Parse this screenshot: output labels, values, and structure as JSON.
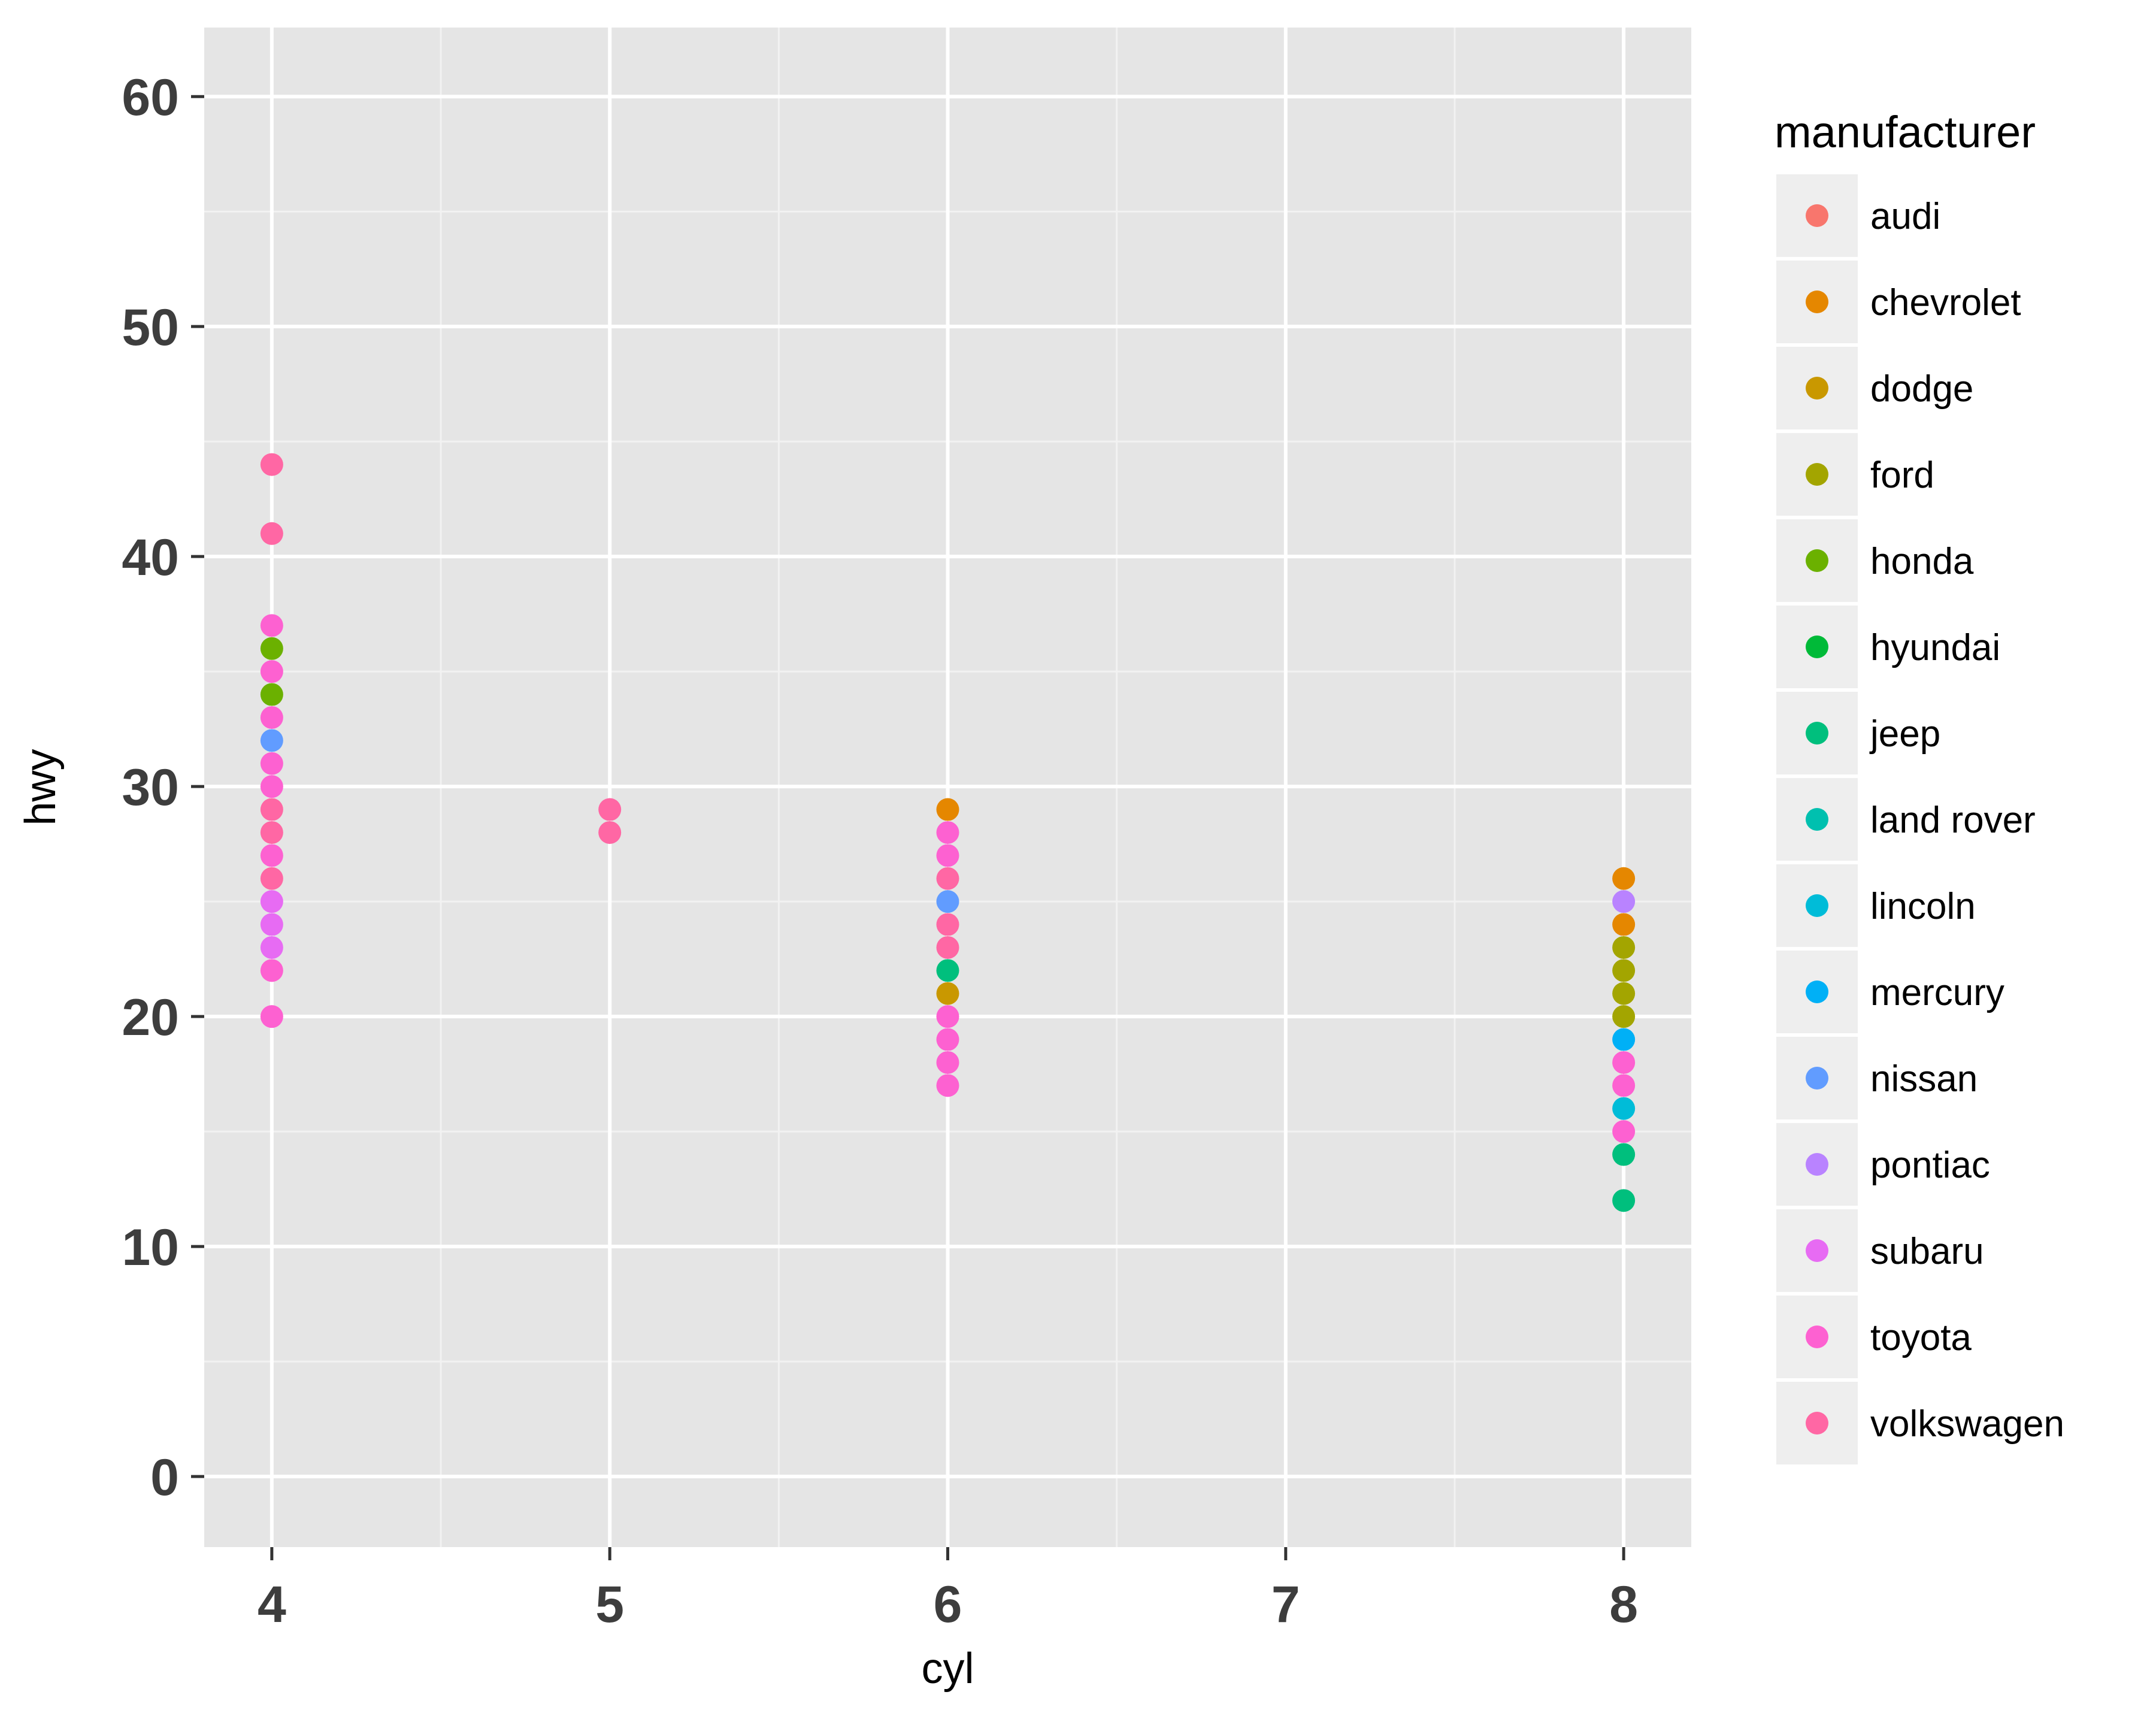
{
  "chart_data": {
    "type": "scatter",
    "title": "",
    "xlabel": "cyl",
    "ylabel": "hwy",
    "xlim": [
      3.8,
      8.2
    ],
    "ylim": [
      -3.07,
      63.0
    ],
    "x_ticks": [
      4,
      5,
      6,
      7,
      8
    ],
    "x_tick_labels": [
      "4",
      "5",
      "6",
      "7",
      "8"
    ],
    "y_ticks": [
      0,
      10,
      20,
      30,
      40,
      50,
      60
    ],
    "y_tick_labels": [
      "0",
      "10",
      "20",
      "30",
      "40",
      "50",
      "60"
    ],
    "grid": true,
    "panel_background": "#e5e5e5",
    "legend": {
      "title": "manufacturer",
      "position": "right",
      "entries": [
        {
          "name": "audi",
          "color": "#F8766D"
        },
        {
          "name": "chevrolet",
          "color": "#E58700"
        },
        {
          "name": "dodge",
          "color": "#C99800"
        },
        {
          "name": "ford",
          "color": "#A3A500"
        },
        {
          "name": "honda",
          "color": "#6BB100"
        },
        {
          "name": "hyundai",
          "color": "#00BA38"
        },
        {
          "name": "jeep",
          "color": "#00BF7D"
        },
        {
          "name": "land rover",
          "color": "#00C0AF"
        },
        {
          "name": "lincoln",
          "color": "#00BCD8"
        },
        {
          "name": "mercury",
          "color": "#00B0F6"
        },
        {
          "name": "nissan",
          "color": "#619CFF"
        },
        {
          "name": "pontiac",
          "color": "#B983FF"
        },
        {
          "name": "subaru",
          "color": "#E76BF3"
        },
        {
          "name": "toyota",
          "color": "#FD61D1"
        },
        {
          "name": "volkswagen",
          "color": "#FF67A4"
        }
      ]
    },
    "series": [
      {
        "name": "audi",
        "points": []
      },
      {
        "name": "chevrolet",
        "points": [
          [
            6,
            29
          ],
          [
            8,
            26
          ],
          [
            8,
            24
          ]
        ]
      },
      {
        "name": "dodge",
        "points": [
          [
            6,
            21
          ]
        ]
      },
      {
        "name": "ford",
        "points": [
          [
            8,
            23
          ],
          [
            8,
            22
          ],
          [
            8,
            21
          ],
          [
            8,
            20
          ]
        ]
      },
      {
        "name": "honda",
        "points": [
          [
            4,
            36
          ],
          [
            4,
            34
          ]
        ]
      },
      {
        "name": "hyundai",
        "points": []
      },
      {
        "name": "jeep",
        "points": [
          [
            6,
            22
          ],
          [
            8,
            14
          ],
          [
            8,
            12
          ]
        ]
      },
      {
        "name": "land rover",
        "points": []
      },
      {
        "name": "lincoln",
        "points": [
          [
            8,
            16
          ]
        ]
      },
      {
        "name": "mercury",
        "points": [
          [
            8,
            19
          ]
        ]
      },
      {
        "name": "nissan",
        "points": [
          [
            4,
            32
          ],
          [
            6,
            25
          ]
        ]
      },
      {
        "name": "pontiac",
        "points": [
          [
            8,
            25
          ]
        ]
      },
      {
        "name": "subaru",
        "points": [
          [
            4,
            25
          ],
          [
            4,
            24
          ],
          [
            4,
            23
          ]
        ]
      },
      {
        "name": "toyota",
        "points": [
          [
            4,
            37
          ],
          [
            4,
            35
          ],
          [
            4,
            33
          ],
          [
            4,
            31
          ],
          [
            4,
            30
          ],
          [
            4,
            27
          ],
          [
            4,
            22
          ],
          [
            4,
            20
          ],
          [
            6,
            28
          ],
          [
            6,
            27
          ],
          [
            6,
            20
          ],
          [
            6,
            19
          ],
          [
            6,
            18
          ],
          [
            6,
            17
          ],
          [
            8,
            18
          ],
          [
            8,
            17
          ],
          [
            8,
            15
          ]
        ]
      },
      {
        "name": "volkswagen",
        "points": [
          [
            4,
            44
          ],
          [
            4,
            41
          ],
          [
            4,
            29
          ],
          [
            4,
            28
          ],
          [
            4,
            26
          ],
          [
            5,
            29
          ],
          [
            5,
            28
          ],
          [
            6,
            26
          ],
          [
            6,
            24
          ],
          [
            6,
            23
          ]
        ]
      }
    ]
  }
}
